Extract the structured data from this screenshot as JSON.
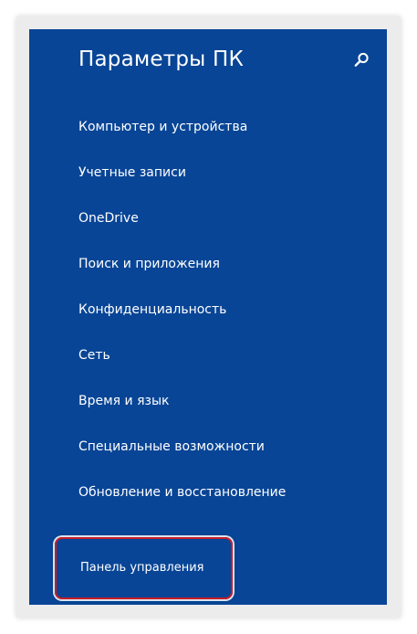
{
  "window": {
    "title": "Параметры ПК"
  },
  "menu": {
    "items": [
      {
        "label": "Компьютер и устройства"
      },
      {
        "label": "Учетные записи"
      },
      {
        "label": "OneDrive"
      },
      {
        "label": "Поиск и приложения"
      },
      {
        "label": "Конфиденциальность"
      },
      {
        "label": "Сеть"
      },
      {
        "label": "Время и язык"
      },
      {
        "label": "Специальные возможности"
      },
      {
        "label": "Обновление и восстановление"
      }
    ],
    "control_panel_label": "Панель управления"
  },
  "icons": {
    "search": "search-icon"
  },
  "colors": {
    "panel_background": "#084596",
    "text": "#ffffff",
    "highlight_border": "#c51d29",
    "frame": "#ececec"
  }
}
